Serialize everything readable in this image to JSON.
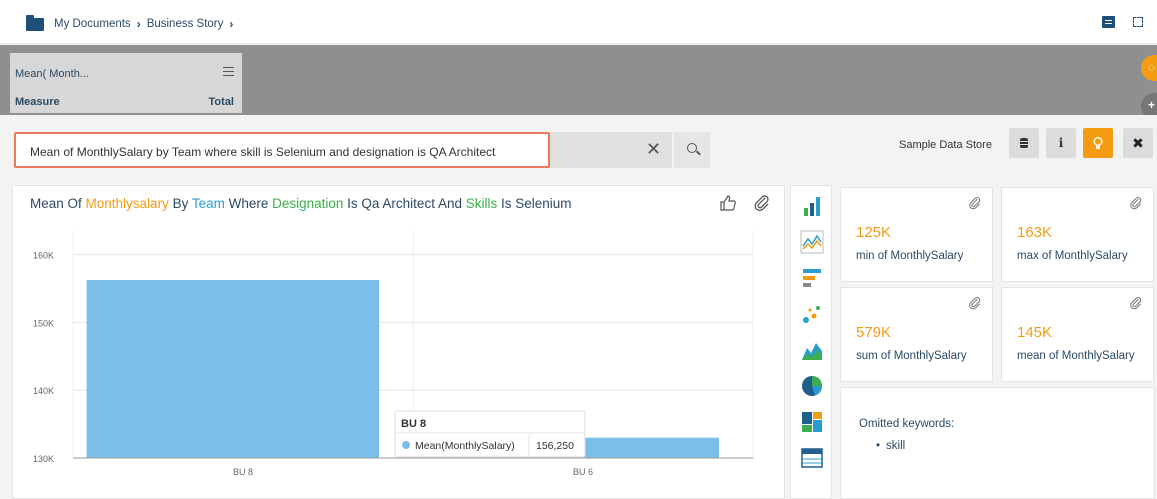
{
  "breadcrumb": {
    "items": [
      "My Documents",
      "Business Story"
    ]
  },
  "measure_card": {
    "title": "Mean( Month...",
    "measure_label": "Measure",
    "total_label": "Total"
  },
  "search": {
    "query": "Mean of MonthlySalary by Team where skill is Selenium and designation is QA Architect"
  },
  "toolbar": {
    "store_label": "Sample Data Store"
  },
  "chart_header": {
    "parts": [
      "Mean Of ",
      "Monthlysalary",
      " By ",
      "Team",
      " Where ",
      "Designation",
      " Is Qa Architect And ",
      "Skills",
      " Is Selenium"
    ]
  },
  "chart_data": {
    "type": "bar",
    "categories": [
      "BU 8",
      "BU 6"
    ],
    "series": [
      {
        "name": "Mean(MonthlySalary)",
        "values": [
          156250,
          133000
        ]
      }
    ],
    "ylim": [
      130000,
      162000
    ],
    "yticks": [
      130000,
      140000,
      150000,
      160000
    ],
    "ytick_labels": [
      "130K",
      "140K",
      "150K",
      "160K"
    ],
    "grid": true,
    "bar_color": "#7bbfe8",
    "tooltip": {
      "category": "BU 8",
      "series": "Mean(MonthlySalary)",
      "value": "156,250"
    }
  },
  "kpis": [
    {
      "value": "125K",
      "label": "min of MonthlySalary"
    },
    {
      "value": "163K",
      "label": "max of MonthlySalary"
    },
    {
      "value": "579K",
      "label": "sum of MonthlySalary"
    },
    {
      "value": "145K",
      "label": "mean of MonthlySalary"
    }
  ],
  "omitted": {
    "title": "Omitted keywords:",
    "items": [
      "skill"
    ]
  },
  "colors": {
    "accent": "#f39c12",
    "title_text": "#2b4a66",
    "search_border": "#e8795a"
  }
}
